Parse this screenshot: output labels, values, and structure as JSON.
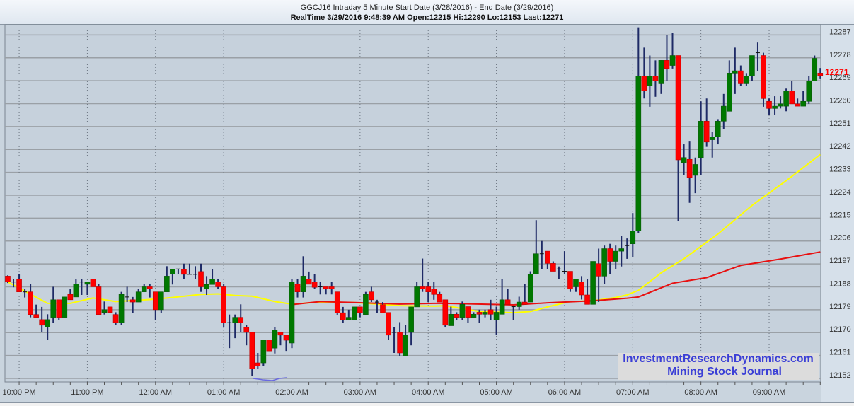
{
  "header": {
    "title": "GGCJ16 Intraday  5 Minute Start Date (3/28/2016) - End Date (3/29/2016)",
    "subtitle": "RealTime 3/29/2016 9:48:39 AM Open:12215 Hi:12290 Lo:12153 Last:12271"
  },
  "watermark": {
    "line1": "InvestmentResearchDynamics.com",
    "line2": "Mining Stock Journal"
  },
  "colors": {
    "up": "#007800",
    "down": "#ff0000",
    "wick": "#1e2a66",
    "ma_fast": "#ffff00",
    "ma_slow": "#e81010",
    "last_label": "#ff0000",
    "plot_bg": "#c6d1dc",
    "grid": "#9aa0a6"
  },
  "chart_data": {
    "type": "candlestick",
    "title": "GGCJ16 Intraday 5 Minute",
    "interval_minutes": 5,
    "first_bar_time": "9:50 PM",
    "ylim": [
      12150.6,
      12291.0
    ],
    "y_ticks": [
      12287,
      12278,
      12269,
      12260,
      12251,
      12242,
      12233,
      12224,
      12215,
      12206,
      12197,
      12188,
      12179,
      12170,
      12161,
      12152
    ],
    "hidden_y_tick": 12269,
    "x_tick_labels": [
      "10:00 PM",
      "11:00 PM",
      "12:00 AM",
      "01:00 AM",
      "02:00 AM",
      "03:00 AM",
      "04:00 AM",
      "05:00 AM",
      "06:00 AM",
      "07:00 AM",
      "08:00 AM",
      "09:00 AM"
    ],
    "first_hour_bar_index": 2,
    "bars_per_hour": 12,
    "last_value": "12271",
    "last_price": 12271,
    "ohlc": [
      [
        12192.2,
        12192.5,
        12189.5,
        12189.9
      ],
      [
        12189.9,
        12191.1,
        12187.8,
        12189.9
      ],
      [
        12191.1,
        12193.1,
        12186.0,
        12186.0
      ],
      [
        12186,
        12187.1,
        12183.8,
        12186
      ],
      [
        12186,
        12189.1,
        12176,
        12177.1
      ],
      [
        12177.1,
        12181,
        12176,
        12176
      ],
      [
        12175.1,
        12180.1,
        12170.1,
        12172.9
      ],
      [
        12172.1,
        12177.2,
        12167,
        12175.1
      ],
      [
        12176,
        12188,
        12173.9,
        12182.9
      ],
      [
        12182.9,
        12182.9,
        12175,
        12176
      ],
      [
        12176,
        12184,
        12176,
        12184
      ],
      [
        12185,
        12187.1,
        12182.9,
        12182.9
      ],
      [
        12184,
        12191.1,
        12184,
        12189.1
      ],
      [
        12189.9,
        12191.1,
        12184.8,
        12189.9
      ],
      [
        12189,
        12189.9,
        12184.8,
        12189.9
      ],
      [
        12191.1,
        12191.1,
        12188,
        12188
      ],
      [
        12188,
        12189.1,
        12177.1,
        12177.1
      ],
      [
        12177.9,
        12182.2,
        12177.1,
        12179
      ],
      [
        12180.1,
        12180.1,
        12177.9,
        12177.9
      ],
      [
        12177.1,
        12178,
        12172.9,
        12173.9
      ],
      [
        12173.9,
        12186,
        12172.9,
        12185
      ],
      [
        12184,
        12188,
        12182,
        12184
      ],
      [
        12182.9,
        12184,
        12177.8,
        12182
      ],
      [
        12182,
        12187.1,
        12182,
        12186
      ],
      [
        12186,
        12189.1,
        12186,
        12188
      ],
      [
        12188,
        12189.1,
        12183.8,
        12187.1
      ],
      [
        12186,
        12186,
        12175,
        12179
      ],
      [
        12179,
        12186,
        12177.8,
        12186
      ],
      [
        12186,
        12196.1,
        12186,
        12192.2
      ],
      [
        12193,
        12194.9,
        12188.9,
        12194.9
      ],
      [
        12195,
        12195,
        12193,
        12195
      ],
      [
        12194.9,
        12197.1,
        12191.1,
        12192.9
      ],
      [
        12192.9,
        12197.1,
        12192.9,
        12192.9
      ],
      [
        12192.9,
        12196.1,
        12191.1,
        12192.9
      ],
      [
        12194,
        12197.1,
        12186,
        12188
      ],
      [
        12187.1,
        12192.2,
        12184.8,
        12188.9
      ],
      [
        12188.9,
        12195,
        12188.9,
        12191.1
      ],
      [
        12189.9,
        12191.1,
        12187.1,
        12188
      ],
      [
        12188,
        12189.1,
        12172,
        12173.9
      ],
      [
        12173.9,
        12177.1,
        12163.9,
        12173.9
      ],
      [
        12173.9,
        12177.1,
        12167.8,
        12176
      ],
      [
        12176,
        12181.1,
        12170.1,
        12173.9
      ],
      [
        12172.1,
        12173,
        12165,
        12170.1
      ],
      [
        12170.1,
        12170.1,
        12153,
        12155.8
      ],
      [
        12158.1,
        12162,
        12155.8,
        12156.9
      ],
      [
        12158.1,
        12167.1,
        12156.9,
        12167.1
      ],
      [
        12167.1,
        12167.1,
        12162.8,
        12162.8
      ],
      [
        12163.9,
        12172.1,
        12161.8,
        12171
      ],
      [
        12170.1,
        12170.1,
        12165,
        12169
      ],
      [
        12169,
        12169,
        12162.8,
        12167
      ],
      [
        12165.9,
        12191.1,
        12163.9,
        12189.9
      ],
      [
        12189.1,
        12191.1,
        12183.8,
        12186
      ],
      [
        12186,
        12200,
        12183.8,
        12192.2
      ],
      [
        12191.1,
        12194,
        12189,
        12189
      ],
      [
        12189.9,
        12192.9,
        12187.1,
        12187.8
      ],
      [
        12188,
        12189.9,
        12185,
        12188
      ],
      [
        12188,
        12188,
        12185,
        12187.1
      ],
      [
        12188,
        12189.9,
        12185,
        12187.1
      ],
      [
        12186,
        12186,
        12177,
        12177.8
      ],
      [
        12177.8,
        12180.1,
        12173.9,
        12175
      ],
      [
        12175,
        12179,
        12175,
        12176
      ],
      [
        12175,
        12180.1,
        12175,
        12180.1
      ],
      [
        12180.1,
        12180.1,
        12176,
        12177.8
      ],
      [
        12177.1,
        12186,
        12177.1,
        12185
      ],
      [
        12186,
        12188,
        12182,
        12182.9
      ],
      [
        12182,
        12182.9,
        12177.8,
        12182
      ],
      [
        12181,
        12182,
        12177.8,
        12177.8
      ],
      [
        12177.9,
        12177.9,
        12167,
        12169
      ],
      [
        12170.1,
        12172.1,
        12162,
        12170.1
      ],
      [
        12170.1,
        12174.1,
        12160.9,
        12162
      ],
      [
        12160.9,
        12173,
        12160.9,
        12169
      ],
      [
        12170.1,
        12180.1,
        12165,
        12180.1
      ],
      [
        12180.1,
        12189.9,
        12180.1,
        12188
      ],
      [
        12188,
        12199.1,
        12186,
        12187.1
      ],
      [
        12188,
        12189.9,
        12182,
        12186
      ],
      [
        12187.1,
        12189.9,
        12182.9,
        12185
      ],
      [
        12185,
        12186,
        12182,
        12182
      ],
      [
        12182.9,
        12182.9,
        12172,
        12172.9
      ],
      [
        12172.7,
        12180.2,
        12172.7,
        12177.2
      ],
      [
        12177.2,
        12178,
        12175,
        12176
      ],
      [
        12176,
        12182.2,
        12175,
        12181.1
      ],
      [
        12180.2,
        12180.2,
        12173.9,
        12176
      ],
      [
        12176,
        12178,
        12176,
        12177.2
      ],
      [
        12178,
        12179,
        12173.9,
        12177.2
      ],
      [
        12177.2,
        12179,
        12176,
        12178
      ],
      [
        12179,
        12182.9,
        12175,
        12177.2
      ],
      [
        12175,
        12180.2,
        12169,
        12178
      ],
      [
        12177.2,
        12191,
        12177.2,
        12182.9
      ],
      [
        12182.9,
        12187.1,
        12181.1,
        12181.1
      ],
      [
        12180.2,
        12180.2,
        12175,
        12180.2
      ],
      [
        12180.2,
        12184.1,
        12179,
        12182
      ],
      [
        12182,
        12189.1,
        12181.1,
        12181.1
      ],
      [
        12182,
        12194.1,
        12182,
        12193
      ],
      [
        12193,
        12214.2,
        12193,
        12201
      ],
      [
        12201,
        12206,
        12195,
        12201
      ],
      [
        12202,
        12202,
        12195,
        12197.2
      ],
      [
        12197.2,
        12198,
        12194.1,
        12194.1
      ],
      [
        12195,
        12196,
        12191,
        12195
      ],
      [
        12194.1,
        12202,
        12193,
        12194.1
      ],
      [
        12194.1,
        12194.1,
        12186,
        12187.1
      ],
      [
        12188,
        12191,
        12186,
        12191
      ],
      [
        12189.9,
        12192.2,
        12183,
        12184.8
      ],
      [
        12184.8,
        12191,
        12181.1,
        12181.1
      ],
      [
        12181.1,
        12198,
        12181.1,
        12198
      ],
      [
        12197.1,
        12203,
        12182,
        12192.2
      ],
      [
        12192.2,
        12204.2,
        12189,
        12203
      ],
      [
        12203,
        12204.9,
        12193,
        12198
      ],
      [
        12198,
        12204.2,
        12195,
        12202
      ],
      [
        12202,
        12208.1,
        12196,
        12203
      ],
      [
        12204.2,
        12207,
        12199,
        12204.2
      ],
      [
        12204.9,
        12217,
        12199.8,
        12210
      ],
      [
        12210,
        12290,
        12209,
        12270.9
      ],
      [
        12270.9,
        12282,
        12262,
        12265
      ],
      [
        12266.9,
        12278.9,
        12258.8,
        12270.9
      ],
      [
        12270.9,
        12277,
        12262.7,
        12268.9
      ],
      [
        12267.8,
        12277,
        12263.8,
        12277
      ],
      [
        12277,
        12287,
        12268.9,
        12273.8
      ],
      [
        12275,
        12287.9,
        12273.8,
        12278.9
      ],
      [
        12278.9,
        12278.9,
        12214,
        12237.9
      ],
      [
        12236.8,
        12244,
        12231.8,
        12238.8
      ],
      [
        12238.1,
        12245.1,
        12221,
        12231
      ],
      [
        12231.8,
        12238.8,
        12224.8,
        12236.1
      ],
      [
        12238.8,
        12260.9,
        12231.8,
        12253.1
      ],
      [
        12253.1,
        12262,
        12243,
        12244.9
      ],
      [
        12245.8,
        12249,
        12238.8,
        12246.9
      ],
      [
        12246.9,
        12253.9,
        12244,
        12253.1
      ],
      [
        12253.1,
        12263.8,
        12249.9,
        12259
      ],
      [
        12257,
        12277,
        12257,
        12272
      ],
      [
        12272,
        12282,
        12263.8,
        12272.9
      ],
      [
        12272.9,
        12275,
        12266.9,
        12267.8
      ],
      [
        12267.8,
        12272,
        12266.9,
        12270.9
      ],
      [
        12270.9,
        12278.9,
        12268.9,
        12278.9
      ],
      [
        12280,
        12284,
        12272.7,
        12280
      ],
      [
        12278.9,
        12280,
        12258.8,
        12262
      ],
      [
        12260.9,
        12262,
        12255.7,
        12258.1
      ],
      [
        12258.1,
        12262.9,
        12255.7,
        12259
      ],
      [
        12259,
        12262.9,
        12258.1,
        12259.9
      ],
      [
        12259,
        12265.9,
        12257,
        12265
      ],
      [
        12265,
        12268.9,
        12259.9,
        12259.9
      ],
      [
        12259.9,
        12262,
        12259,
        12259
      ],
      [
        12259,
        12265,
        12259,
        12260.9
      ],
      [
        12260.9,
        12270.9,
        12259.9,
        12268.9
      ],
      [
        12268.9,
        12278.9,
        12268.9,
        12277.8
      ],
      [
        12272,
        12274,
        12269.9,
        12271
      ]
    ],
    "series": [
      {
        "name": "fast moving average",
        "points": [
          [
            0,
            12189.9
          ],
          [
            7,
            12181.5
          ],
          [
            11,
            12181.5
          ],
          [
            15,
            12183.6
          ],
          [
            19,
            12182.2
          ],
          [
            25,
            12183
          ],
          [
            29,
            12183.8
          ],
          [
            34,
            12185
          ],
          [
            37,
            12185.2
          ],
          [
            40,
            12184.6
          ],
          [
            43,
            12184.3
          ],
          [
            47,
            12182.2
          ],
          [
            50,
            12181.2
          ],
          [
            55,
            12182
          ],
          [
            61,
            12181.8
          ],
          [
            69,
            12180.6
          ],
          [
            75,
            12180.4
          ],
          [
            77,
            12180.6
          ],
          [
            83,
            12178.3
          ],
          [
            89,
            12177.8
          ],
          [
            92,
            12178.3
          ],
          [
            95,
            12180.1
          ],
          [
            99,
            12182.2
          ],
          [
            103,
            12182.5
          ],
          [
            107,
            12183.8
          ],
          [
            109,
            12184.8
          ],
          [
            111,
            12186.6
          ],
          [
            115,
            12193.5
          ],
          [
            119,
            12199
          ],
          [
            125,
            12208.8
          ],
          [
            131,
            12220
          ],
          [
            137,
            12229.7
          ],
          [
            143,
            12240
          ]
        ]
      },
      {
        "name": "slow moving average",
        "points": [
          [
            50,
            12181
          ],
          [
            55,
            12182.2
          ],
          [
            61,
            12181.8
          ],
          [
            69,
            12181.2
          ],
          [
            75,
            12181.5
          ],
          [
            77,
            12181.5
          ],
          [
            89,
            12180.9
          ],
          [
            95,
            12181.7
          ],
          [
            103,
            12182.5
          ],
          [
            109,
            12183.5
          ],
          [
            111,
            12184
          ],
          [
            117,
            12189.4
          ],
          [
            123,
            12191.6
          ],
          [
            129,
            12196.4
          ],
          [
            136,
            12198.9
          ],
          [
            143,
            12201.7
          ]
        ]
      }
    ]
  }
}
